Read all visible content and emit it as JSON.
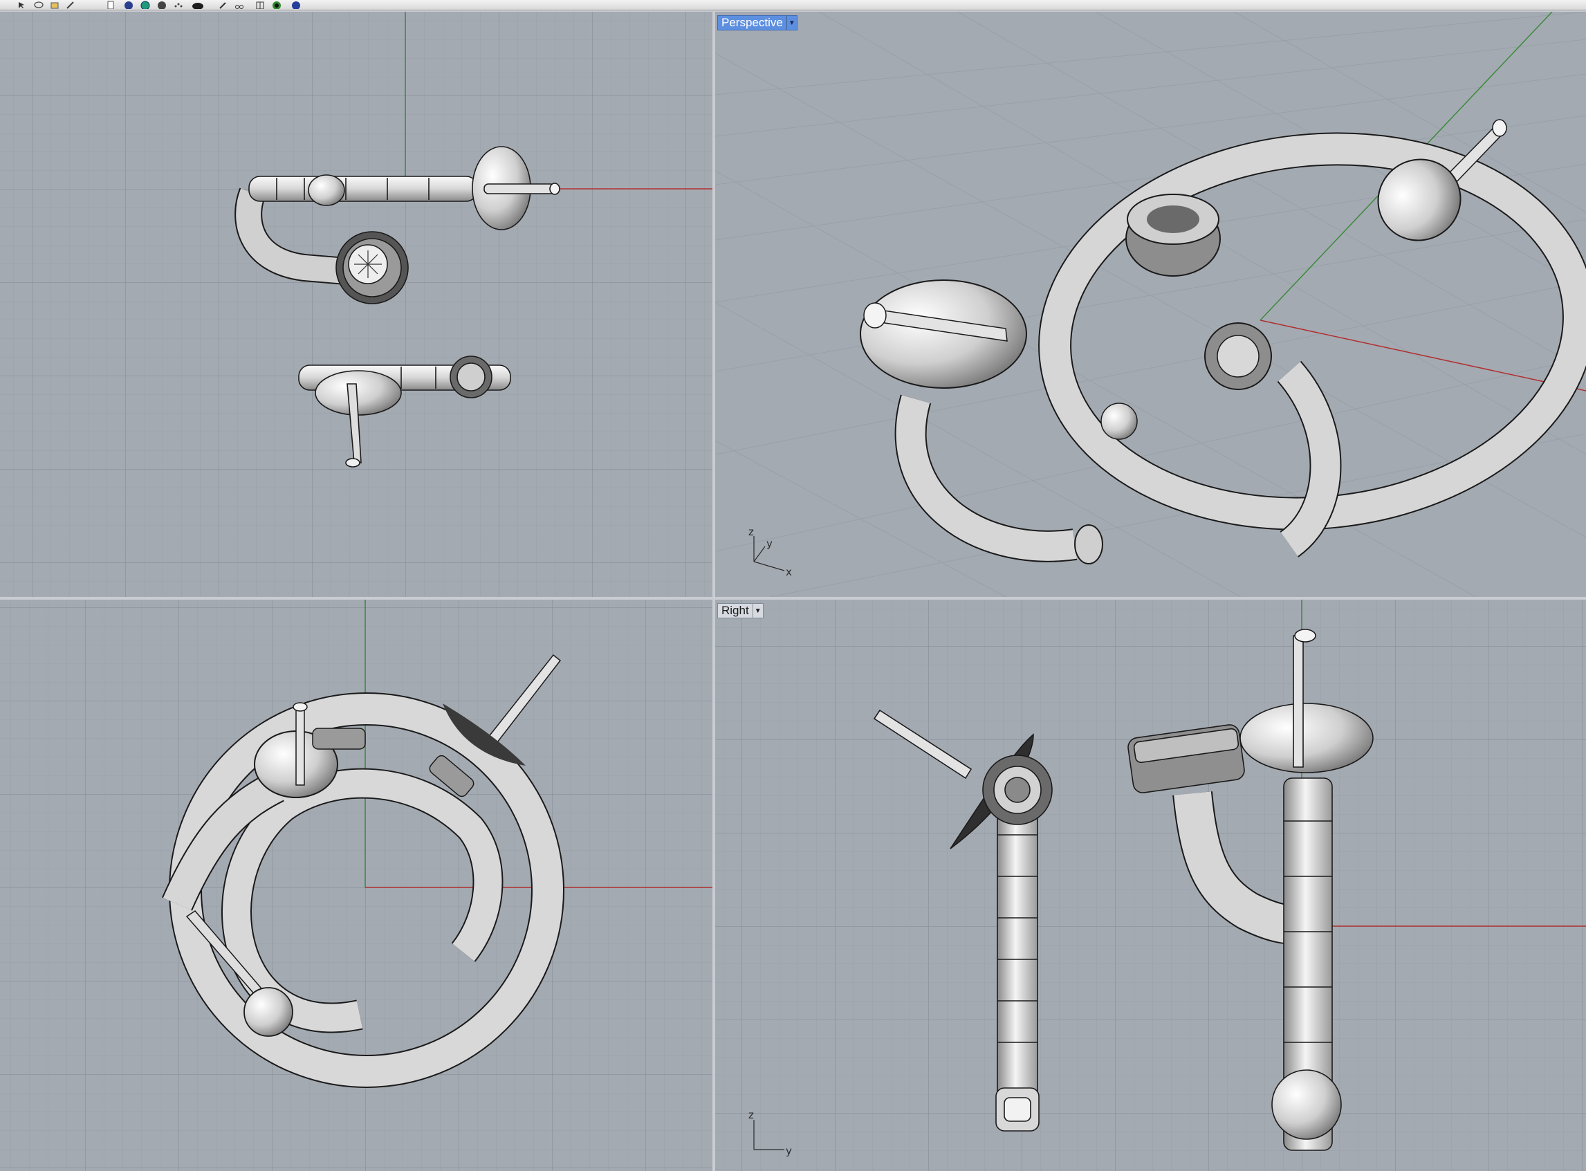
{
  "toolbar": {
    "icons": [
      "select-icon",
      "lasso-icon",
      "layer-icon",
      "pencil-icon",
      "document-icon",
      "render-sphere-icon",
      "globe-icon",
      "shade-icon",
      "points-icon",
      "material-ball-icon",
      "cut-icon",
      "scissors-icon",
      "grid-icon",
      "plugin-icon",
      "help-icon"
    ]
  },
  "viewports": {
    "top": {
      "label": ""
    },
    "perspective": {
      "label": "Perspective",
      "dropdown_icon": "dropdown-arrow-icon"
    },
    "front": {
      "label": ""
    },
    "right": {
      "label": "Right",
      "dropdown_icon": "dropdown-arrow-icon"
    }
  },
  "axis_triads": {
    "perspective": {
      "z": "z",
      "y": "y",
      "x": "x"
    },
    "right": {
      "z": "z",
      "y": "y"
    }
  },
  "colors": {
    "viewport_background": "#a4aab2",
    "grid_minor": "#99a0a8",
    "grid_major": "#8c939c",
    "x_axis": "#b03030",
    "y_axis": "#3a8a3a",
    "active_label": "#5d8fe0",
    "viewport_border": "#c9ccd1"
  }
}
